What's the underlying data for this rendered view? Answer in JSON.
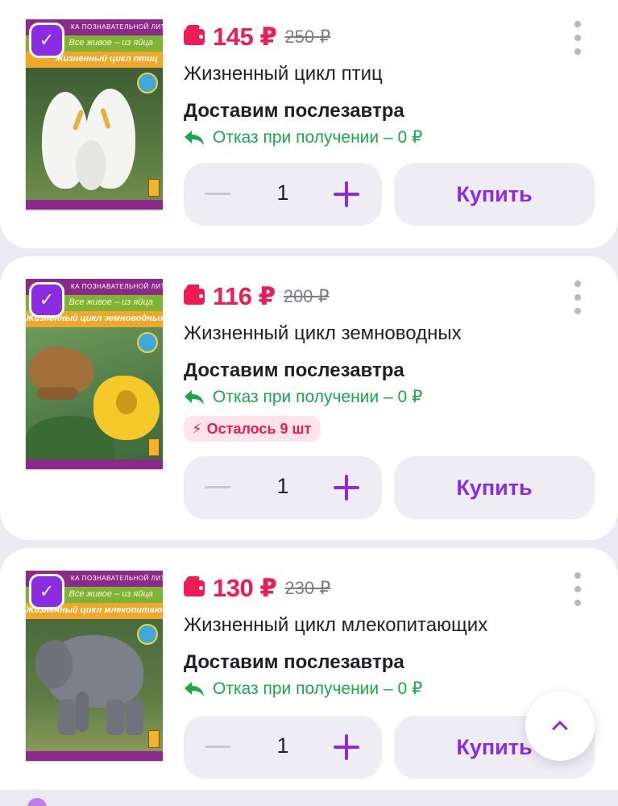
{
  "colors": {
    "accent": "#8b2be2",
    "price": "#ed1c54",
    "return_green": "#19a84a",
    "background": "#ebe9f1"
  },
  "icons": {
    "checkbox": "checkmark-icon",
    "price": "wallet-icon",
    "return": "return-arrow-icon",
    "stock": "lightning-icon",
    "menu": "more-vertical-icon",
    "scroll_top": "chevron-up-icon"
  },
  "cover": {
    "series_top": "ка познавательной литературы",
    "series": "Все живое – из яйца"
  },
  "products": [
    {
      "cover_title": "Жизненный цикл птиц",
      "price": "145 ₽",
      "old_price": "250 ₽",
      "title": "Жизненный цикл птиц",
      "delivery": "Доставим послезавтра",
      "return_text": "Отказ при получении – 0 ₽",
      "quantity": "1",
      "buy_label": "Купить",
      "selected": true
    },
    {
      "cover_title": "Жизненный цикл земноводных",
      "price": "116 ₽",
      "old_price": "200 ₽",
      "title": "Жизненный цикл земноводных",
      "delivery": "Доставим послезавтра",
      "return_text": "Отказ при получении – 0 ₽",
      "stock": "Осталось 9 шт",
      "quantity": "1",
      "buy_label": "Купить",
      "selected": true
    },
    {
      "cover_title": "Жизненный цикл млекопитающих",
      "price": "130 ₽",
      "old_price": "230 ₽",
      "title": "Жизненный цикл млекопитающих",
      "delivery": "Доставим послезавтра",
      "return_text": "Отказ при получении – 0 ₽",
      "quantity": "1",
      "buy_label": "Купить",
      "selected": true
    }
  ]
}
